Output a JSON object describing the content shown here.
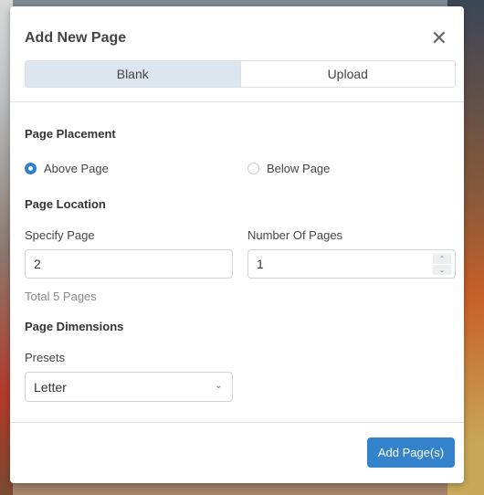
{
  "modal": {
    "title": "Add New Page",
    "close_icon": "close-icon",
    "tabs": [
      {
        "label": "Blank",
        "active": true
      },
      {
        "label": "Upload",
        "active": false
      }
    ],
    "placement": {
      "heading": "Page Placement",
      "options": [
        {
          "label": "Above Page",
          "selected": true
        },
        {
          "label": "Below Page",
          "selected": false
        }
      ]
    },
    "location": {
      "heading": "Page Location",
      "specify_label": "Specify Page",
      "specify_value": "2",
      "total": "Total 5 Pages",
      "count_label": "Number Of Pages",
      "count_value": "1"
    },
    "dimensions": {
      "heading": "Page Dimensions",
      "presets_label": "Presets",
      "presets_value": "Letter"
    },
    "submit_label": "Add Page(s)",
    "accent_color": "#3382cc"
  }
}
